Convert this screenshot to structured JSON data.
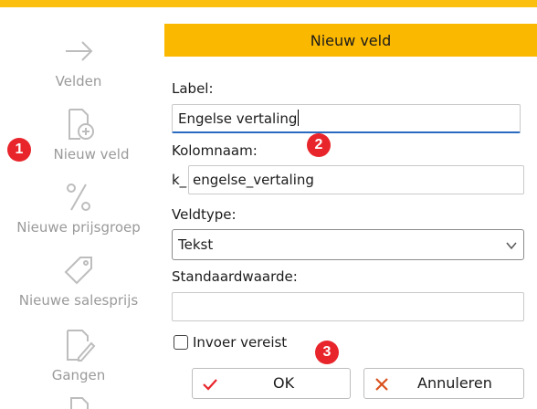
{
  "sidebar": {
    "items": [
      {
        "label": "Velden",
        "icon": "arrow-right-icon"
      },
      {
        "label": "Nieuw veld",
        "icon": "new-document-icon"
      },
      {
        "label": "Nieuwe prijsgroep",
        "icon": "percent-icon"
      },
      {
        "label": "Nieuwe salesprijs",
        "icon": "price-tag-icon"
      },
      {
        "label": "Gangen",
        "icon": "edit-document-icon"
      }
    ]
  },
  "badges": [
    "1",
    "2",
    "3"
  ],
  "dialog": {
    "title": "Nieuw veld",
    "label_caption": "Label:",
    "label_value": "Engelse vertaling",
    "column_caption": "Kolomnaam:",
    "column_prefix": "k_",
    "column_value": "engelse_vertaling",
    "type_caption": "Veldtype:",
    "type_value": "Tekst",
    "default_caption": "Standaardwaarde:",
    "default_value": "",
    "required_label": "Invoer vereist",
    "required_checked": false,
    "ok_label": "OK",
    "cancel_label": "Annuleren"
  },
  "colors": {
    "header": "#fbb800",
    "top_bar": "#fbbf10",
    "badge": "#e8252b",
    "ok_check": "#e8252b",
    "cancel_x": "#d9501c",
    "focus_underline": "#2a6ac0"
  }
}
